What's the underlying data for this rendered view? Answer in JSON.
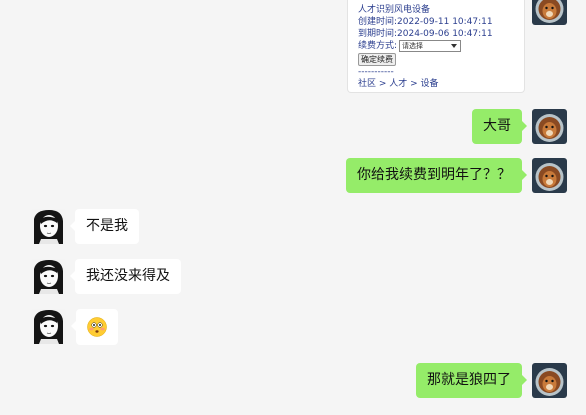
{
  "card": {
    "line1": "人才识别风电设备",
    "line2": "创建时间:2022-09-11 10:47:11",
    "line3": "到期时间:2024-09-06 10:47:11",
    "select_label": "续费方式:",
    "select_value": "请选择",
    "confirm_label": "确定续费",
    "separator": "-----------",
    "footer": "社区 > 人才 > 设备"
  },
  "messages": [
    {
      "sender": "self",
      "text": "大哥"
    },
    {
      "sender": "self",
      "text": "你给我续费到明年了？？"
    },
    {
      "sender": "other",
      "text": "不是我"
    },
    {
      "sender": "other",
      "text": "我还没来得及"
    },
    {
      "sender": "other",
      "emoji": "flushed-face"
    },
    {
      "sender": "self",
      "text": "那就是狼四了"
    }
  ],
  "colors": {
    "background": "#f5f5f5",
    "self_bubble": "#95ec69",
    "other_bubble": "#ffffff"
  }
}
